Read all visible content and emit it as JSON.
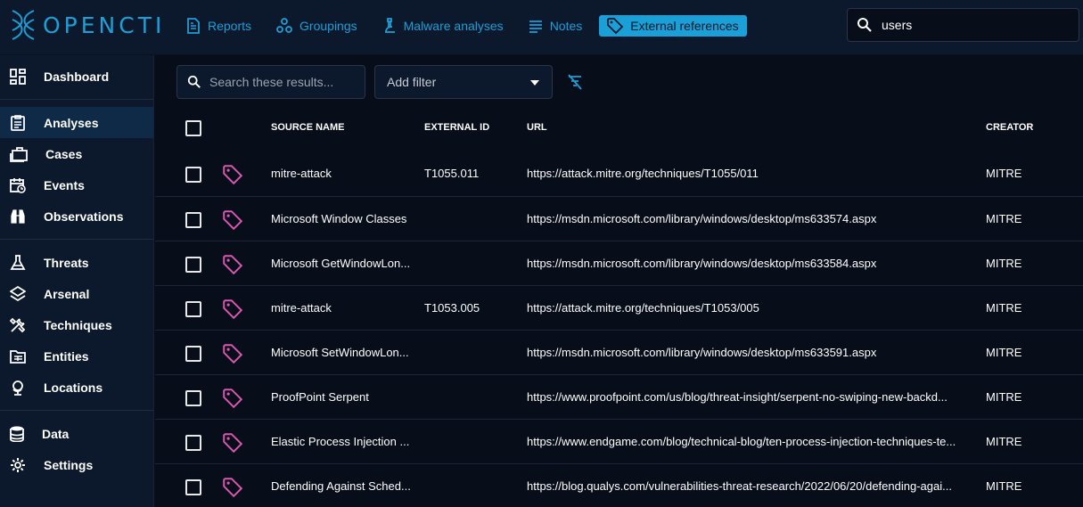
{
  "brand": {
    "name": "OPENCTI"
  },
  "topnav": [
    {
      "label": "Reports",
      "icon": "report-icon",
      "active": false
    },
    {
      "label": "Groupings",
      "icon": "groupings-icon",
      "active": false
    },
    {
      "label": "Malware analyses",
      "icon": "microscope-icon",
      "active": false
    },
    {
      "label": "Notes",
      "icon": "notes-icon",
      "active": false
    },
    {
      "label": "External references",
      "icon": "tag-icon",
      "active": true
    }
  ],
  "global_search": {
    "value": "users"
  },
  "sidebar": {
    "items": [
      {
        "label": "Dashboard",
        "icon": "dashboard-icon"
      },
      {
        "label": "Analyses",
        "icon": "analyses-icon",
        "active": true
      },
      {
        "label": "Cases",
        "icon": "cases-icon"
      },
      {
        "label": "Events",
        "icon": "events-icon"
      },
      {
        "label": "Observations",
        "icon": "binoculars-icon"
      },
      {
        "label": "Threats",
        "icon": "flask-icon"
      },
      {
        "label": "Arsenal",
        "icon": "layers-icon"
      },
      {
        "label": "Techniques",
        "icon": "tools-icon"
      },
      {
        "label": "Entities",
        "icon": "folder-table-icon"
      },
      {
        "label": "Locations",
        "icon": "globe-icon"
      },
      {
        "label": "Data",
        "icon": "database-icon"
      },
      {
        "label": "Settings",
        "icon": "gear-icon"
      }
    ]
  },
  "toolbar": {
    "search_placeholder": "Search these results...",
    "filter_label": "Add filter"
  },
  "table": {
    "columns": [
      "SOURCE NAME",
      "EXTERNAL ID",
      "URL",
      "CREATOR"
    ],
    "rows": [
      {
        "source": "mitre-attack",
        "external_id": "T1055.011",
        "url": "https://attack.mitre.org/techniques/T1055/011",
        "creator": "MITRE"
      },
      {
        "source": "Microsoft Window Classes",
        "external_id": "",
        "url": "https://msdn.microsoft.com/library/windows/desktop/ms633574.aspx",
        "creator": "MITRE"
      },
      {
        "source": "Microsoft GetWindowLon...",
        "external_id": "",
        "url": "https://msdn.microsoft.com/library/windows/desktop/ms633584.aspx",
        "creator": "MITRE"
      },
      {
        "source": "mitre-attack",
        "external_id": "T1053.005",
        "url": "https://attack.mitre.org/techniques/T1053/005",
        "creator": "MITRE"
      },
      {
        "source": "Microsoft SetWindowLon...",
        "external_id": "",
        "url": "https://msdn.microsoft.com/library/windows/desktop/ms633591.aspx",
        "creator": "MITRE"
      },
      {
        "source": "ProofPoint Serpent",
        "external_id": "",
        "url": "https://www.proofpoint.com/us/blog/threat-insight/serpent-no-swiping-new-backd...",
        "creator": "MITRE"
      },
      {
        "source": "Elastic Process Injection ...",
        "external_id": "",
        "url": "https://www.endgame.com/blog/technical-blog/ten-process-injection-techniques-te...",
        "creator": "MITRE"
      },
      {
        "source": "Defending Against Sched...",
        "external_id": "",
        "url": "https://blog.qualys.com/vulnerabilities-threat-research/2022/06/20/defending-agai...",
        "creator": "MITRE"
      }
    ]
  },
  "colors": {
    "accent": "#1a9fd6",
    "tag": "#d957b1",
    "background": "#070d19",
    "panel": "#0c182c"
  }
}
